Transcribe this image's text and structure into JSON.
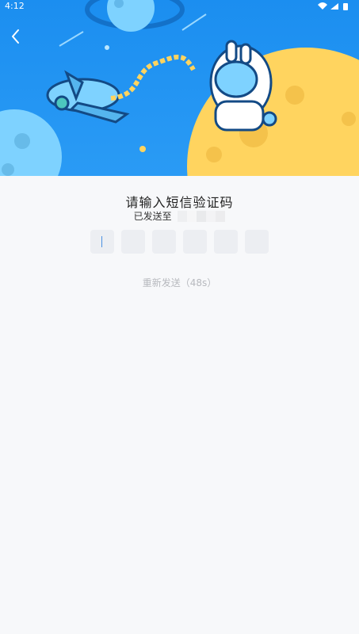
{
  "status_bar": {
    "time": "4:12",
    "icons": [
      "wifi-icon",
      "signal-icon",
      "battery-icon"
    ]
  },
  "header": {
    "back_icon": "chevron-left-icon",
    "illustration": "astronaut-spaceship-planets",
    "colors": {
      "sky_blue": "#1b8ef0",
      "planet_yellow": "#ffd45f"
    }
  },
  "verify": {
    "title": "请输入短信验证码",
    "sent_to_label": "已发送至",
    "phone_masked": "",
    "code_length": 6,
    "resend_label": "重新发送（48s）"
  }
}
